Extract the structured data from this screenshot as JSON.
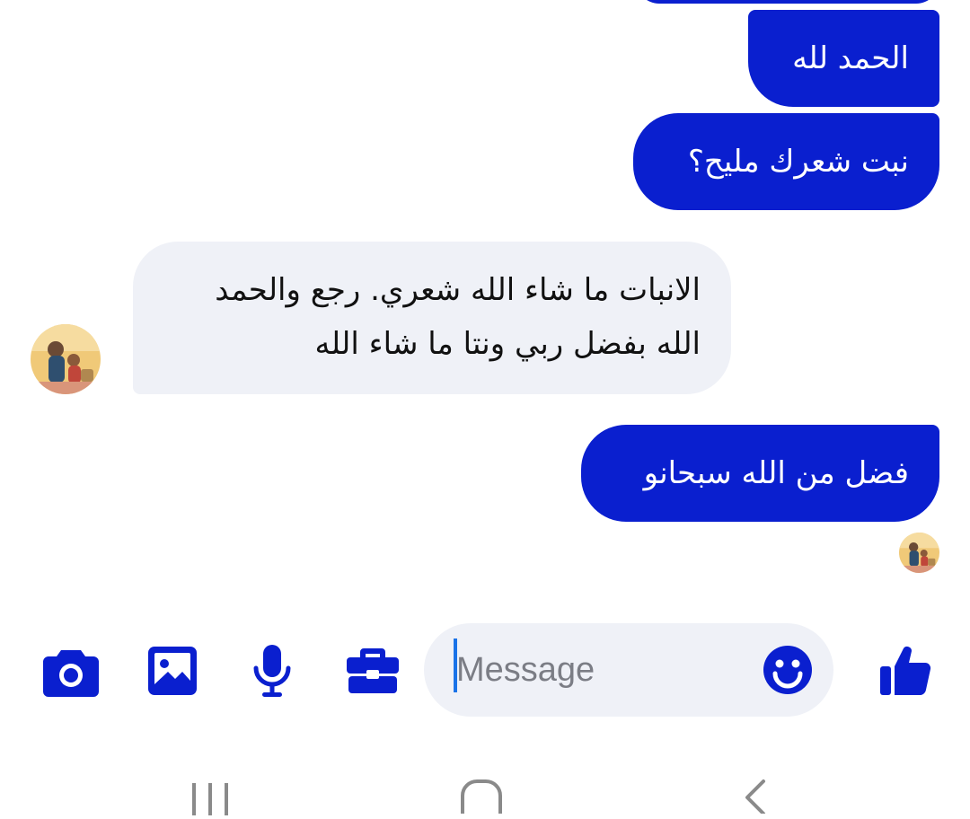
{
  "conversation": {
    "messages": [
      {
        "direction": "out",
        "text": "الحمد لله"
      },
      {
        "direction": "out",
        "text": "نبت شعرك مليح؟"
      },
      {
        "direction": "in",
        "text": "الانبات ما شاء الله شعري. رجع والحمد الله بفضل ربي ونتا ما شاء الله"
      },
      {
        "direction": "out",
        "text": "فضل من الله سبحانو"
      }
    ]
  },
  "composer": {
    "placeholder": "Message",
    "icons": [
      "camera-icon",
      "image-icon",
      "microphone-icon",
      "briefcase-icon",
      "emoji-icon",
      "thumbs-up-icon"
    ]
  },
  "nav": {
    "icons": [
      "recent-apps-icon",
      "home-icon",
      "back-icon"
    ]
  },
  "colors": {
    "accent": "#0a1fcf",
    "incoming_bubble": "#eff1f7",
    "input_background": "#eff1f7",
    "caret": "#1a73e8"
  }
}
